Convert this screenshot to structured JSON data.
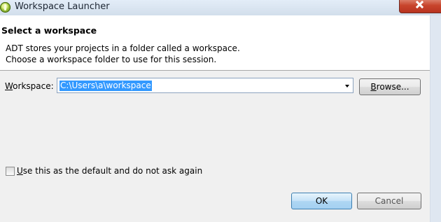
{
  "window": {
    "title": "Workspace Launcher"
  },
  "header": {
    "title": "Select a workspace",
    "description_line1": "ADT stores your projects in a folder called a workspace.",
    "description_line2": "Choose a workspace folder to use for this session."
  },
  "workspace": {
    "label_mnemonic": "W",
    "label_rest": "orkspace:",
    "value": "C:\\Users\\a\\workspace",
    "browse_mnemonic": "B",
    "browse_rest": "rowse..."
  },
  "default_option": {
    "label_mnemonic": "U",
    "label_rest": "se this as the default and do not ask again",
    "checked": false
  },
  "buttons": {
    "ok": "OK",
    "cancel": "Cancel"
  },
  "icons": {
    "app": "adt-icon",
    "close": "close-icon",
    "dropdown": "chevron-down-icon"
  },
  "colors": {
    "selection": "#3399ff",
    "close_button": "#c8452d",
    "header_background": "#ffffff",
    "content_background": "#f0f0f0"
  }
}
